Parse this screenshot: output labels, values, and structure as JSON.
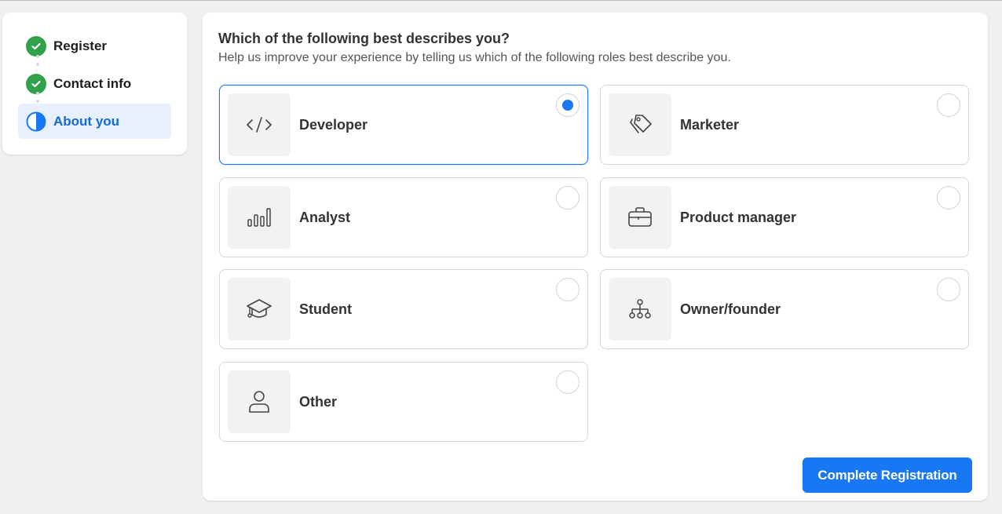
{
  "steps": [
    {
      "label": "Register",
      "status": "complete"
    },
    {
      "label": "Contact info",
      "status": "complete"
    },
    {
      "label": "About you",
      "status": "in-progress"
    }
  ],
  "question": {
    "title": "Which of the following best describes you?",
    "subtitle": "Help us improve your experience by telling us which of the following roles best describe you."
  },
  "options": [
    {
      "label": "Developer",
      "icon": "code-icon",
      "selected": true
    },
    {
      "label": "Marketer",
      "icon": "tags-icon",
      "selected": false
    },
    {
      "label": "Analyst",
      "icon": "bar-chart-icon",
      "selected": false
    },
    {
      "label": "Product manager",
      "icon": "briefcase-icon",
      "selected": false
    },
    {
      "label": "Student",
      "icon": "graduation-cap-icon",
      "selected": false
    },
    {
      "label": "Owner/founder",
      "icon": "org-chart-icon",
      "selected": false
    },
    {
      "label": "Other",
      "icon": "person-icon",
      "selected": false
    }
  ],
  "actions": {
    "complete_label": "Complete Registration"
  },
  "colors": {
    "accent": "#1877f2",
    "success": "#31a24c",
    "active_step_bg": "#e7f0fc"
  }
}
